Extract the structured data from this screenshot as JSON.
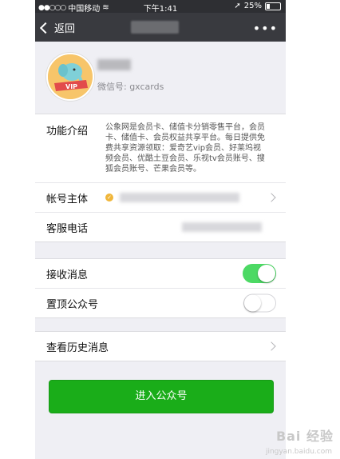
{
  "status_bar": {
    "carrier": "中国移动",
    "time": "下午1:41",
    "battery": "25%"
  },
  "nav": {
    "back_label": "返回",
    "more_label": "•••"
  },
  "profile": {
    "wechat_id": "微信号: gxcards"
  },
  "info": {
    "function_label": "功能介绍",
    "function_text": "公象网是会员卡、储值卡分销零售平台，会员卡、储值卡、会员权益共享平台。每日提供免费共享资源领取：爱奇艺vip会员、好莱坞视频会员、优酷土豆会员、乐视tv会员账号、搜狐会员账号、芒果会员等。",
    "account_label": "帐号主体",
    "phone_label": "客服电话"
  },
  "settings": {
    "receive_label": "接收消息",
    "receive_on": true,
    "pin_label": "置顶公众号",
    "pin_on": false
  },
  "history": {
    "label": "查看历史消息"
  },
  "enter_button": {
    "label": "进入公众号"
  },
  "watermark": {
    "text": "Bai 经验",
    "sub": "jingyan.baidu.com"
  },
  "colors": {
    "nav_bg": "#393a3f",
    "toggle_on": "#4cd964",
    "button_green": "#1aad19"
  }
}
